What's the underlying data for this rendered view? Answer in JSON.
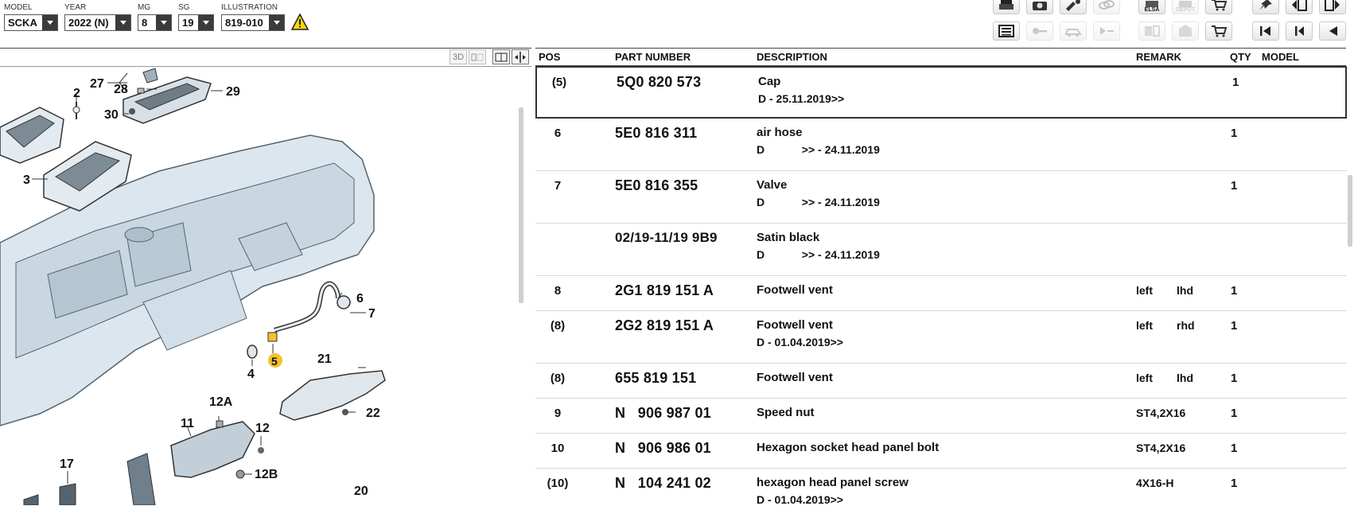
{
  "selectors": {
    "model": {
      "label": "MODEL",
      "value": "SCKA"
    },
    "year": {
      "label": "YEAR",
      "value": "2022 (N)"
    },
    "mg": {
      "label": "MG",
      "value": "8"
    },
    "sg": {
      "label": "SG",
      "value": "19"
    },
    "illustration": {
      "label": "ILLUSTRATION",
      "value": "819-010"
    }
  },
  "toolbar": {
    "elsa_label": "ELSA",
    "depot_label": "DEPOT"
  },
  "view_buttons": {
    "three_d": "3D"
  },
  "table": {
    "headers": {
      "pos": "POS",
      "part_number": "PART NUMBER",
      "description": "DESCRIPTION",
      "remark": "REMARK",
      "qty": "QTY",
      "model": "MODEL"
    },
    "rows": [
      {
        "pos": "(5)",
        "part": "5Q0 820 573",
        "desc": "Cap",
        "sub": "D - 25.11.2019>>",
        "remark": "",
        "remark2": "",
        "qty": "1"
      },
      {
        "pos": "6",
        "part": "5E0 816 311",
        "desc": "air hose",
        "sub": "D            >> - 24.11.2019",
        "remark": "",
        "remark2": "",
        "qty": "1"
      },
      {
        "pos": "7",
        "part": "5E0 816 355",
        "desc": "Valve",
        "sub": "D            >> - 24.11.2019",
        "remark": "",
        "remark2": "",
        "qty": "1"
      },
      {
        "pos": "",
        "part": "02/19-11/19 9B9",
        "desc": "Satin black",
        "sub": "D            >> - 24.11.2019",
        "remark": "",
        "remark2": "",
        "qty": ""
      },
      {
        "pos": "8",
        "part": "2G1 819 151 A",
        "desc": "Footwell vent",
        "sub": "",
        "remark": "left",
        "remark2": "lhd",
        "qty": "1"
      },
      {
        "pos": "(8)",
        "part": "2G2 819 151 A",
        "desc": "Footwell vent",
        "sub": "D - 01.04.2019>>",
        "remark": "left",
        "remark2": "rhd",
        "qty": "1"
      },
      {
        "pos": "(8)",
        "part": "655 819 151",
        "desc": "Footwell vent",
        "sub": "",
        "remark": "left",
        "remark2": "lhd",
        "qty": "1"
      },
      {
        "pos": "9",
        "part": "N   906 987 01",
        "desc": "Speed nut",
        "sub": "",
        "remark": "ST4,2X16",
        "remark2": "",
        "qty": "1"
      },
      {
        "pos": "10",
        "part": "N   906 986 01",
        "desc": "Hexagon socket head panel bolt",
        "sub": "",
        "remark": "ST4,2X16",
        "remark2": "",
        "qty": "1"
      },
      {
        "pos": "(10)",
        "part": "N   104 241 02",
        "desc": "hexagon head panel screw",
        "sub": "D - 01.04.2019>>",
        "remark": "4X16-H",
        "remark2": "",
        "qty": "1"
      }
    ]
  },
  "illustration": {
    "callouts": [
      {
        "id": "c27",
        "text": "27"
      },
      {
        "id": "c28",
        "text": "28"
      },
      {
        "id": "c29",
        "text": "29"
      },
      {
        "id": "c2",
        "text": "2"
      },
      {
        "id": "c30",
        "text": "30"
      },
      {
        "id": "c3",
        "text": "3"
      },
      {
        "id": "c6",
        "text": "6"
      },
      {
        "id": "c7",
        "text": "7"
      },
      {
        "id": "c5",
        "text": "5"
      },
      {
        "id": "c4",
        "text": "4"
      },
      {
        "id": "c21",
        "text": "21"
      },
      {
        "id": "c22",
        "text": "22"
      },
      {
        "id": "c12A",
        "text": "12A"
      },
      {
        "id": "c11",
        "text": "11"
      },
      {
        "id": "c12",
        "text": "12"
      },
      {
        "id": "c12B",
        "text": "12B"
      },
      {
        "id": "c17",
        "text": "17"
      },
      {
        "id": "c20",
        "text": "20"
      }
    ],
    "highlight_color": "#f2c230"
  }
}
